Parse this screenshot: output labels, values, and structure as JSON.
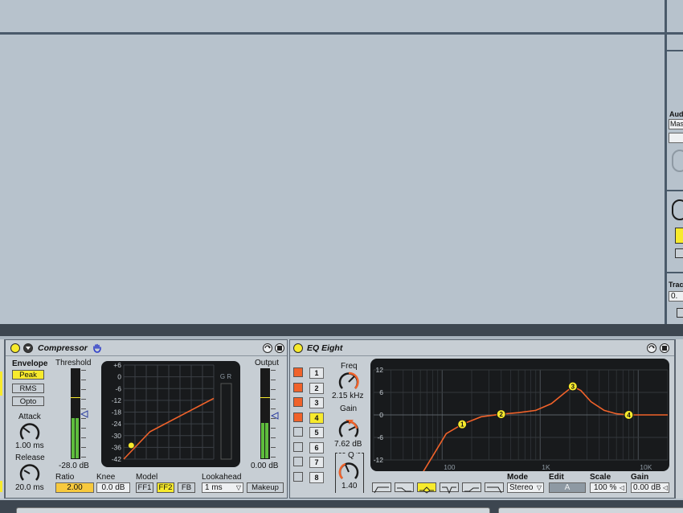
{
  "colors": {
    "background": "#b7c2cc",
    "device_bg": "#c7ced4",
    "accent_yellow": "#f7ea2c",
    "curve_orange": "#f0622a",
    "screen_dark": "#181a1c",
    "meter_green": "#5fbd3d"
  },
  "right_strip": {
    "audio_label": "Aud",
    "audio_value": "Mas",
    "track_label": "Trac",
    "track_value": "0."
  },
  "compressor": {
    "title": "Compressor",
    "envelope_label": "Envelope",
    "envelope_options": [
      "Peak",
      "RMS",
      "Opto"
    ],
    "envelope_selected": "Peak",
    "threshold_label": "Threshold",
    "threshold_value": "-28.0 dB",
    "attack_label": "Attack",
    "attack_value": "1.00 ms",
    "release_label": "Release",
    "release_value": "20.0 ms",
    "ratio_label": "Ratio",
    "ratio_value": "2.00",
    "knee_label": "Knee",
    "knee_value": "0.0 dB",
    "model_label": "Model",
    "model_options": [
      "FF1",
      "FF2",
      "FB"
    ],
    "model_selected": "FF2",
    "lookahead_label": "Lookahead",
    "lookahead_value": "1 ms",
    "output_label": "Output",
    "output_value": "0.00 dB",
    "makeup_label": "Makeup",
    "gr_label": "G R",
    "graph_ticks": [
      "+6",
      "0",
      "-6",
      "-12",
      "-18",
      "-24",
      "-30",
      "-36",
      "-42"
    ]
  },
  "eq": {
    "title": "EQ Eight",
    "band_numbers": [
      "1",
      "2",
      "3",
      "4",
      "5",
      "6",
      "7",
      "8"
    ],
    "band_active": [
      true,
      true,
      true,
      true,
      false,
      false,
      false,
      false
    ],
    "freq_label": "Freq",
    "freq_value": "2.15 kHz",
    "gain_label": "Gain",
    "gain_value": "7.62 dB",
    "q_label": "Q",
    "q_value": "1.40",
    "y_ticks": [
      "12",
      "6",
      "0",
      "-6",
      "-12"
    ],
    "x_ticks": [
      "100",
      "1K",
      "10K"
    ],
    "mode_label": "Mode",
    "mode_value": "Stereo",
    "edit_label": "Edit",
    "edit_value": "A",
    "scale_label": "Scale",
    "scale_value": "100 %",
    "gain_out_label": "Gain",
    "gain_out_value": "0.00 dB",
    "node_labels": [
      "1",
      "2",
      "3",
      "4"
    ]
  }
}
